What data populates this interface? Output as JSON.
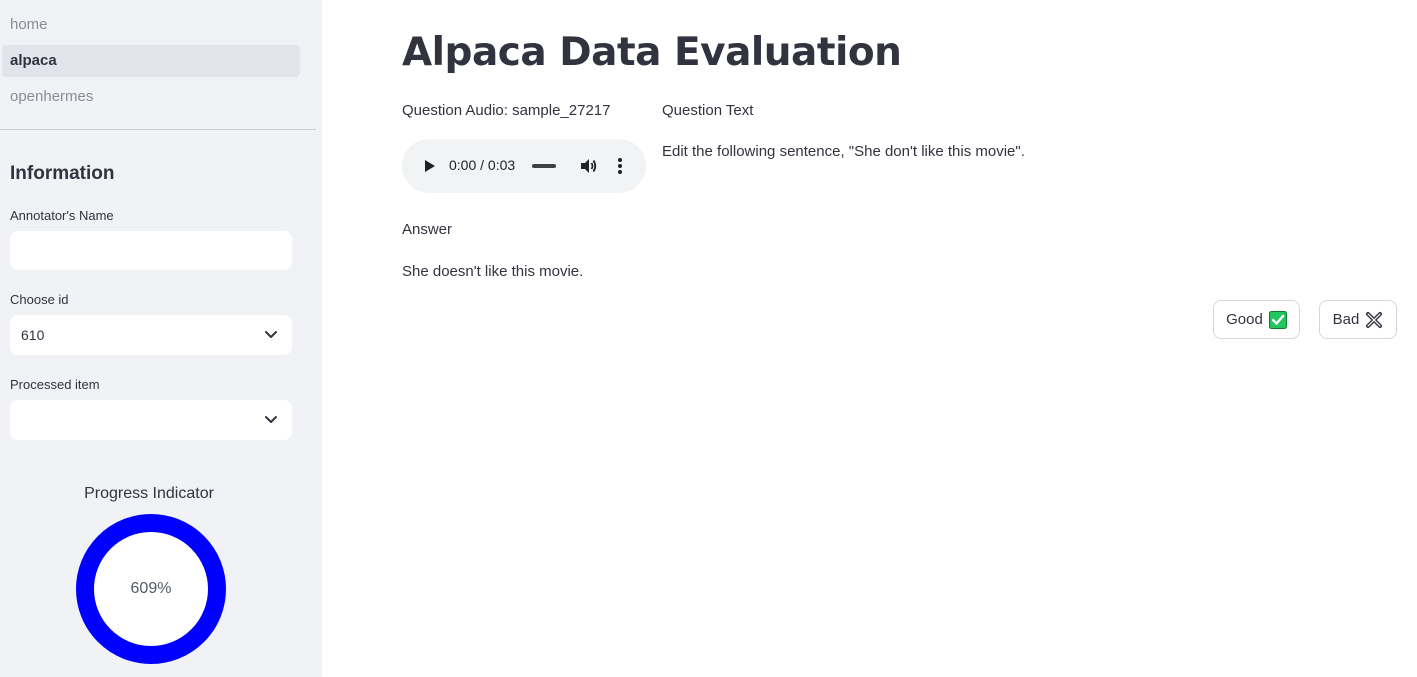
{
  "sidebar": {
    "nav": [
      {
        "label": "home",
        "active": false
      },
      {
        "label": "alpaca",
        "active": true
      },
      {
        "label": "openhermes",
        "active": false
      }
    ],
    "section_title": "Information",
    "annotator_name": {
      "label": "Annotator's Name",
      "value": ""
    },
    "choose_id": {
      "label": "Choose id",
      "value": "610"
    },
    "processed_item": {
      "label": "Processed item",
      "value": ""
    },
    "progress": {
      "title": "Progress Indicator",
      "value_text": "609%",
      "ring_color": "#0000ff"
    }
  },
  "main": {
    "title": "Alpaca Data Evaluation",
    "question_audio_label": "Question Audio: sample_27217",
    "audio": {
      "time": "0:00 / 0:03"
    },
    "question_text_label": "Question Text",
    "question_text": "Edit the following sentence, \"She don't like this movie\".",
    "answer_label": "Answer",
    "answer_text": "She doesn't like this movie.",
    "buttons": {
      "good": {
        "label": "Good",
        "icon": "check-mark-icon",
        "color": "#22c55e"
      },
      "bad": {
        "label": "Bad",
        "icon": "cross-mark-icon"
      }
    }
  }
}
